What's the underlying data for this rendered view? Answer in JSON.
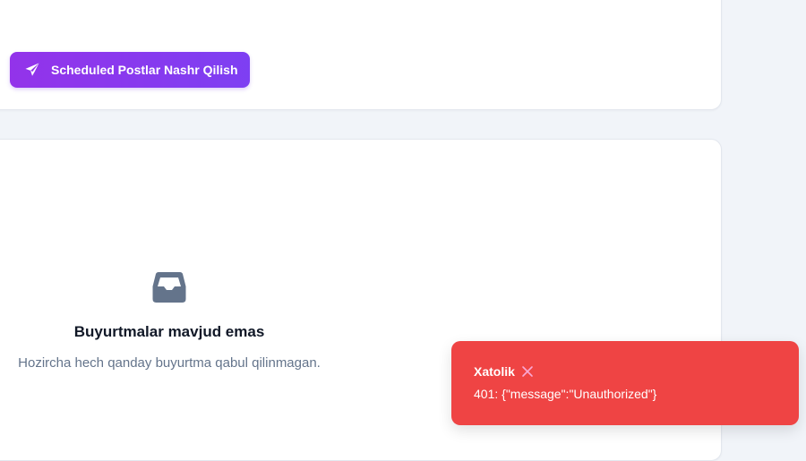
{
  "actions": {
    "publish_label": "Scheduled Postlar Nashr Qilish",
    "publish_icon": "paper-plane-icon"
  },
  "orders": {
    "empty_icon": "inbox-icon",
    "empty_title": "Buyurtmalar mavjud emas",
    "empty_subtitle": "Hozircha hech qanday buyurtma qabul qilinmagan."
  },
  "toast": {
    "title": "Xatolik",
    "close_icon": "close-icon",
    "message": "401: {\"message\":\"Unauthorized\"}",
    "background": "#ef4444",
    "close_color": "#f9a8d4"
  },
  "colors": {
    "accent_start": "#9333ea",
    "accent_end": "#7e3ff2",
    "page_background": "#f1f4f9",
    "muted_icon": "#64748b"
  }
}
